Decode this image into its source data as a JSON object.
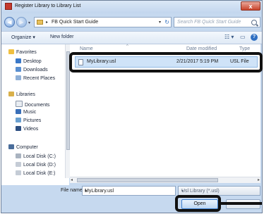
{
  "window": {
    "title": "Register Library to Library List",
    "close_label": "x"
  },
  "address": {
    "breadcrumb_arrow": "▸",
    "path": "FB Quick Start Guide",
    "search_placeholder": "Search FB Quick Start Guide"
  },
  "toolbar": {
    "organize": "Organize ▾",
    "new_folder": "New folder",
    "help": "?"
  },
  "sidebar": {
    "favorites": "Favorites",
    "desktop": "Desktop",
    "downloads": "Downloads",
    "recent_places": "Recent Places",
    "libraries": "Libraries",
    "documents": "Documents",
    "music": "Music",
    "pictures": "Pictures",
    "videos": "Videos",
    "computer": "Computer",
    "disk_c": "Local Disk (C:)",
    "disk_d": "Local Disk (D:)",
    "disk_e": "Local Disk (E:)"
  },
  "columns": {
    "name": "Name",
    "date": "Date modified",
    "type": "Type"
  },
  "file": {
    "name": "MyLibrary.usl",
    "date": "2/21/2017 5:19 PM",
    "type": "USL File"
  },
  "footer": {
    "file_name_label": "File name:",
    "file_name_value": "MyLibrary.usl",
    "filter": "Usl Library (*.usl)",
    "open": "Open"
  },
  "colors": {
    "highlight": "#111111",
    "selection": "#cfe3f8",
    "accent": "#3c7fd1"
  }
}
